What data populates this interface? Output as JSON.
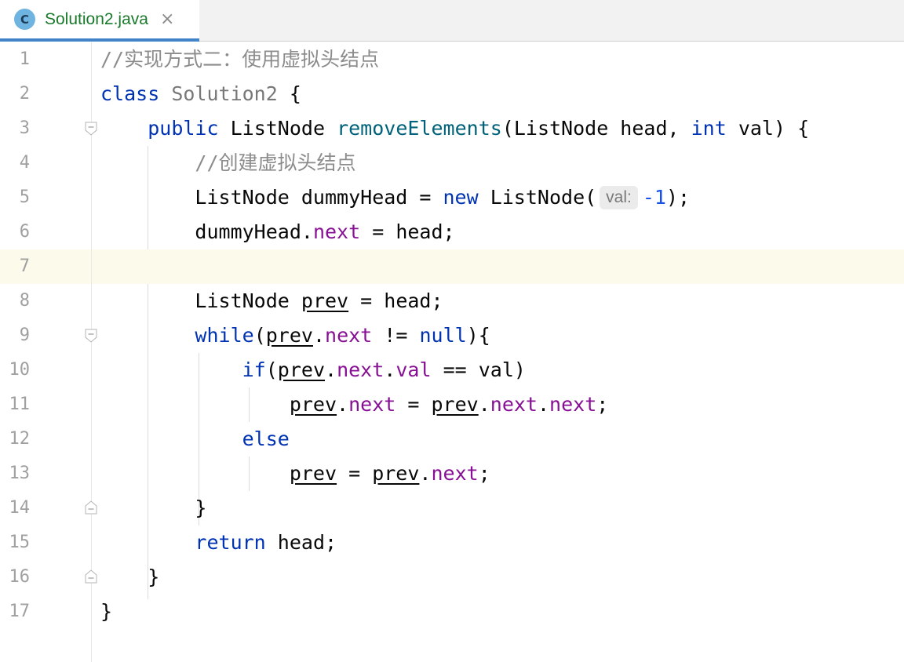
{
  "tab": {
    "icon_letter": "C",
    "title": "Solution2.java",
    "close": "×",
    "icon": "class-icon"
  },
  "line_numbers": [
    "1",
    "2",
    "3",
    "4",
    "5",
    "6",
    "7",
    "8",
    "9",
    "10",
    "11",
    "12",
    "13",
    "14",
    "15",
    "16",
    "17"
  ],
  "current_line": 7,
  "code": {
    "l1": {
      "comment": "//实现方式二：使用虚拟头结点"
    },
    "l2": {
      "kw": "class",
      "name": "Solution2",
      "rest": " {"
    },
    "l3": {
      "kw": "public",
      "type": "ListNode",
      "method": "removeElements",
      "params1": "(ListNode head, ",
      "kw2": "int",
      "params2": " val) {"
    },
    "l4": {
      "comment": "//创建虚拟头结点"
    },
    "l5": {
      "pre": "ListNode dummyHead = ",
      "kw": "new",
      "ctor": " ListNode(",
      "hint": "val:",
      "num": "-1",
      "post": ");"
    },
    "l6": {
      "obj": "dummyHead",
      "dot": ".",
      "field": "next",
      "post": " = head;"
    },
    "l7": {
      "text": ""
    },
    "l8": {
      "pre": "ListNode ",
      "var": "prev",
      "post": " = head;"
    },
    "l9": {
      "kw": "while",
      "p1": "(",
      "var": "prev",
      "dot": ".",
      "field": "next",
      "op": " != ",
      "kw2": "null",
      "post": "){"
    },
    "l10": {
      "kw": "if",
      "p1": "(",
      "var": "prev",
      "dot1": ".",
      "f1": "next",
      "dot2": ".",
      "f2": "val",
      "post": " == val)"
    },
    "l11": {
      "var1": "prev",
      "dot1": ".",
      "f1": "next",
      "eq": " = ",
      "var2": "prev",
      "dot2": ".",
      "f2": "next",
      "dot3": ".",
      "f3": "next",
      "post": ";"
    },
    "l12": {
      "kw": "else"
    },
    "l13": {
      "var1": "prev",
      "eq": " = ",
      "var2": "prev",
      "dot": ".",
      "field": "next",
      "post": ";"
    },
    "l14": {
      "text": "}"
    },
    "l15": {
      "kw": "return",
      "post": " head;"
    },
    "l16": {
      "text": "}"
    },
    "l17": {
      "text": "}"
    }
  }
}
